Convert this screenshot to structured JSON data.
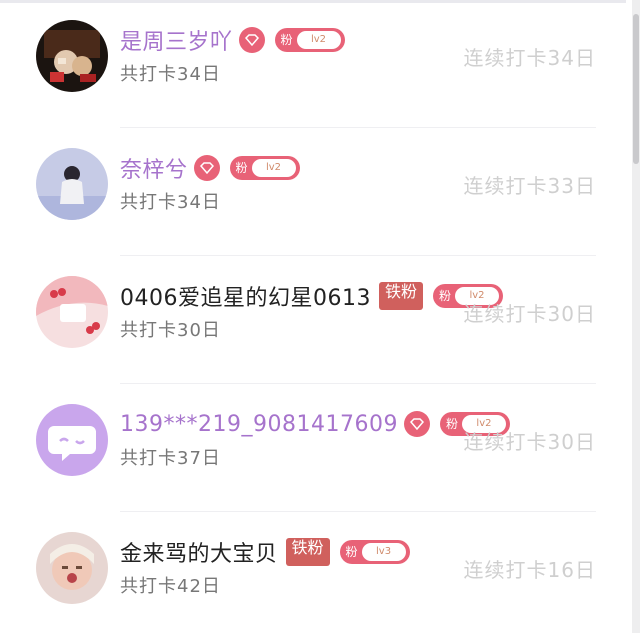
{
  "rows": [
    {
      "name": "是周三岁吖",
      "name_color": "purple",
      "has_vip": true,
      "iron": "",
      "fan_label": "粉",
      "fan_level": "lv2",
      "total": "共打卡34日",
      "streak": "连续打卡34日"
    },
    {
      "name": "奈梓兮",
      "name_color": "purple",
      "has_vip": true,
      "iron": "",
      "fan_label": "粉",
      "fan_level": "lv2",
      "total": "共打卡34日",
      "streak": "连续打卡33日"
    },
    {
      "name": "0406爱追星的幻星0613",
      "name_color": "black",
      "has_vip": false,
      "iron": "铁粉",
      "fan_label": "粉",
      "fan_level": "lv2",
      "total": "共打卡30日",
      "streak": "连续打卡30日"
    },
    {
      "name": "139***219_9081417609",
      "name_color": "purple",
      "has_vip": true,
      "iron": "",
      "fan_label": "粉",
      "fan_level": "lv2",
      "total": "共打卡37日",
      "streak": "连续打卡30日"
    },
    {
      "name": "金来骂的大宝贝",
      "name_color": "black",
      "has_vip": false,
      "iron": "铁粉",
      "fan_label": "粉",
      "fan_level": "lv3",
      "total": "共打卡42日",
      "streak": "连续打卡16日"
    }
  ],
  "colors": {
    "accent_pink": "#e86277",
    "name_purple": "#a673cc",
    "iron_red": "#d0605d",
    "streak_gray": "#cfcfcf"
  },
  "icons": {
    "vip": "diamond-icon",
    "fan": "fan-badge"
  }
}
